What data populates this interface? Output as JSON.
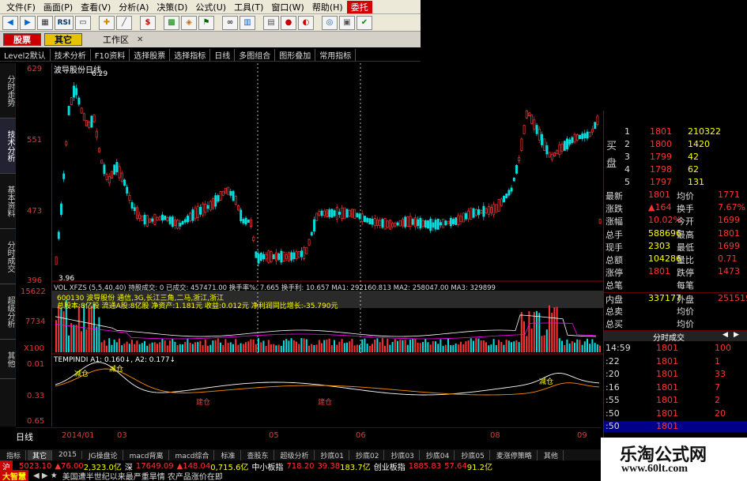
{
  "menubar": {
    "items": [
      "文件(F)",
      "画面(P)",
      "查看(V)",
      "分析(A)",
      "决策(D)",
      "公式(U)",
      "工具(T)",
      "窗口(W)",
      "帮助(H)",
      "委托"
    ]
  },
  "toolbar": {
    "icons": [
      "back-icon",
      "forward-icon",
      "grid-icon",
      "list-icon",
      "rsi-icon",
      "window-icon",
      "chart-icon",
      "add-icon",
      "ruler-icon",
      "dollar-icon",
      "pattern-icon",
      "hazard-icon",
      "flag-icon",
      "binoculars-icon",
      "bars-icon",
      "calendar-icon",
      "circle-icon",
      "candy-icon",
      "bubble-icon",
      "note-icon",
      "check-icon"
    ],
    "rsi": "RSI"
  },
  "tabs": {
    "stock": "股票",
    "other": "其它",
    "workspace": "工作区"
  },
  "funcbar": [
    "Level2默认",
    "技术分析",
    "F10资料",
    "选择股票",
    "选择指标",
    "日线",
    "多图组合",
    "图形叠加",
    "常用指标"
  ],
  "vtabs": [
    "分时走势",
    "技术分析",
    "基本资料",
    "分时成交",
    "超级分析",
    "其他"
  ],
  "yaxis": {
    "labels": [
      "629",
      "551",
      "473",
      "396",
      "15622",
      "7734",
      "X100",
      "0.01",
      "0.33",
      "0.65"
    ]
  },
  "chart": {
    "title": "波导股份日线",
    "high_mark": "6.29",
    "low_mark": "3.96",
    "vol_line": "VOL XFZS (5,5,40,40)  持股成交: 0  已成交: 457471.00  换手率%: 7.665  换手利: 10.657  MA1: 292160.813  MA2: 258047.00  MA3: 329899",
    "stock_line": "600130  波导股份  通信,3G,长江三角,二马,浙江,浙江",
    "fund_line": "总股本:8亿股  流通A股:8亿股  净资产:1.181元  收益:0.012元  净利润同比增长:-35.790元",
    "ind_line": "TEMPINDI  A1: 0.160↓,  A2: 0.177↓",
    "signals": [
      "减仓",
      "减仓",
      "建仓",
      "建仓",
      "减仓"
    ],
    "dates": [
      "2014/01",
      "03",
      "05",
      "06",
      "08",
      "09"
    ]
  },
  "quote": {
    "asks": [
      {
        "n": "1",
        "p": "1801",
        "v": "210322"
      },
      {
        "n": "2",
        "p": "1800",
        "v": "1420"
      },
      {
        "n": "3",
        "p": "1799",
        "v": "42"
      },
      {
        "n": "4",
        "p": "1798",
        "v": "62"
      },
      {
        "n": "5",
        "p": "1797",
        "v": "131"
      }
    ],
    "side_top": "买",
    "side_bot": "盘",
    "stats": [
      [
        "最新",
        "1801",
        "均价",
        "1771"
      ],
      [
        "涨跌",
        "▲164",
        "换手",
        "7.67%"
      ],
      [
        "涨幅",
        "10.02%",
        "今开",
        "1699"
      ],
      [
        "总手",
        "588696",
        "最高",
        "1801"
      ],
      [
        "现手",
        "2303",
        "最低",
        "1699"
      ],
      [
        "总额",
        "104286",
        "量比",
        "0.71"
      ],
      [
        "涨停",
        "1801",
        "跌停",
        "1473"
      ],
      [
        "总笔",
        "",
        "每笔",
        ""
      ],
      [
        "内盘",
        "337177",
        "外盘",
        "251519"
      ],
      [
        "总卖",
        "",
        "均价",
        ""
      ],
      [
        "总买",
        "",
        "均价",
        ""
      ]
    ],
    "tick_header": "分时成交",
    "ticks": [
      [
        "14:59",
        "1801",
        "100"
      ],
      [
        ":22",
        "1801",
        "1"
      ],
      [
        ":20",
        "1801",
        "33"
      ],
      [
        ":16",
        "1801",
        "7"
      ],
      [
        ":55",
        "1801",
        "2"
      ],
      [
        ":50",
        "1801",
        "20"
      ],
      [
        ":50",
        "1801",
        ""
      ]
    ]
  },
  "bottom": {
    "day_label": "日线",
    "tabs": [
      "指标",
      "其它",
      "2015",
      "JG操盘论",
      "macd背离",
      "macd综合",
      "标准",
      "查股东",
      "超级分析",
      "抄底01",
      "抄底02",
      "抄底03",
      "抄底04",
      "抄底05",
      "麦涨停策略",
      "其他"
    ],
    "index_line": {
      "sh": "沪",
      "sh_val": "5023.10",
      "sh_chg": "▲76.00",
      "sh_amt": "2,323.0亿",
      "sz": "深",
      "sz_val": "17649.09",
      "sz_chg": "▲148.04",
      "sz_amt": "0,715.6亿",
      "mid": "中小板指",
      "mid_val": "718.20",
      "mid_chg": "39.38",
      "mid_amt": "183.7亿",
      "gem": "创业板指",
      "gem_val": "1885.83",
      "gem_chg": "57.64",
      "gem_amt": "91.2亿"
    },
    "logo": "大智慧",
    "news": "美国遭半世纪以来最严重旱情 农产品涨价在即"
  },
  "brand": {
    "name": "乐淘公式网",
    "url": "www.60lt.com"
  },
  "colors": {
    "up": "#ff3333",
    "down": "#00e0e0",
    "yellow": "#ffff00",
    "menu_red": "#d40000"
  }
}
